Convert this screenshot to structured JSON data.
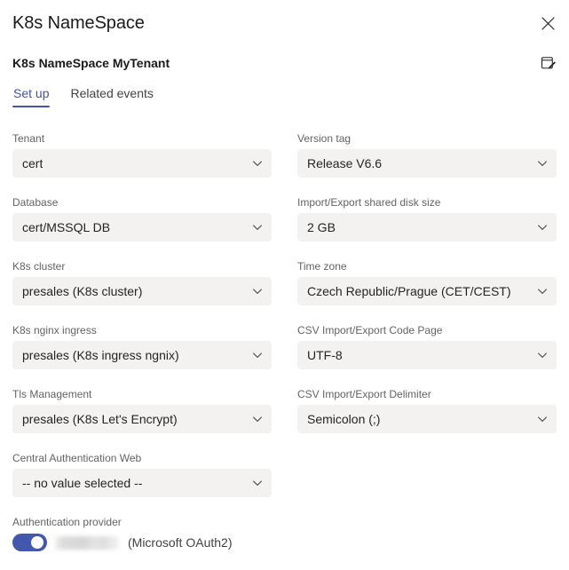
{
  "header": {
    "title": "K8s NameSpace",
    "subtitle": "K8s NameSpace MyTenant",
    "close_icon": "close-icon",
    "edit_icon": "edit-note-icon"
  },
  "tabs": [
    {
      "label": "Set up",
      "active": true
    },
    {
      "label": "Related events",
      "active": false
    }
  ],
  "colors": {
    "accent": "#4253a8",
    "toggle_on": "#4458ab",
    "field_bg": "#f3f2f1",
    "label": "#646464",
    "text": "#242424"
  },
  "left_column": [
    {
      "label": "Tenant",
      "value": "cert"
    },
    {
      "label": "Database",
      "value": "cert/MSSQL DB"
    },
    {
      "label": "K8s cluster",
      "value": "presales (K8s cluster)"
    },
    {
      "label": "K8s nginx ingress",
      "value": "presales (K8s ingress ngnix)"
    },
    {
      "label": "Tls Management",
      "value": "presales (K8s Let's Encrypt)"
    },
    {
      "label": "Central Authentication Web",
      "value": "-- no value selected --"
    }
  ],
  "right_column": [
    {
      "label": "Version tag",
      "value": "Release V6.6"
    },
    {
      "label": "Import/Export shared disk size",
      "value": "2 GB"
    },
    {
      "label": "Time zone",
      "value": "Czech Republic/Prague (CET/CEST)"
    },
    {
      "label": "CSV Import/Export Code Page",
      "value": "UTF-8"
    },
    {
      "label": "CSV Import/Export Delimiter",
      "value": "Semicolon (;)"
    }
  ],
  "auth_provider": {
    "label": "Authentication provider",
    "toggle_on": true,
    "redacted_value": "",
    "caption": "(Microsoft OAuth2)"
  }
}
